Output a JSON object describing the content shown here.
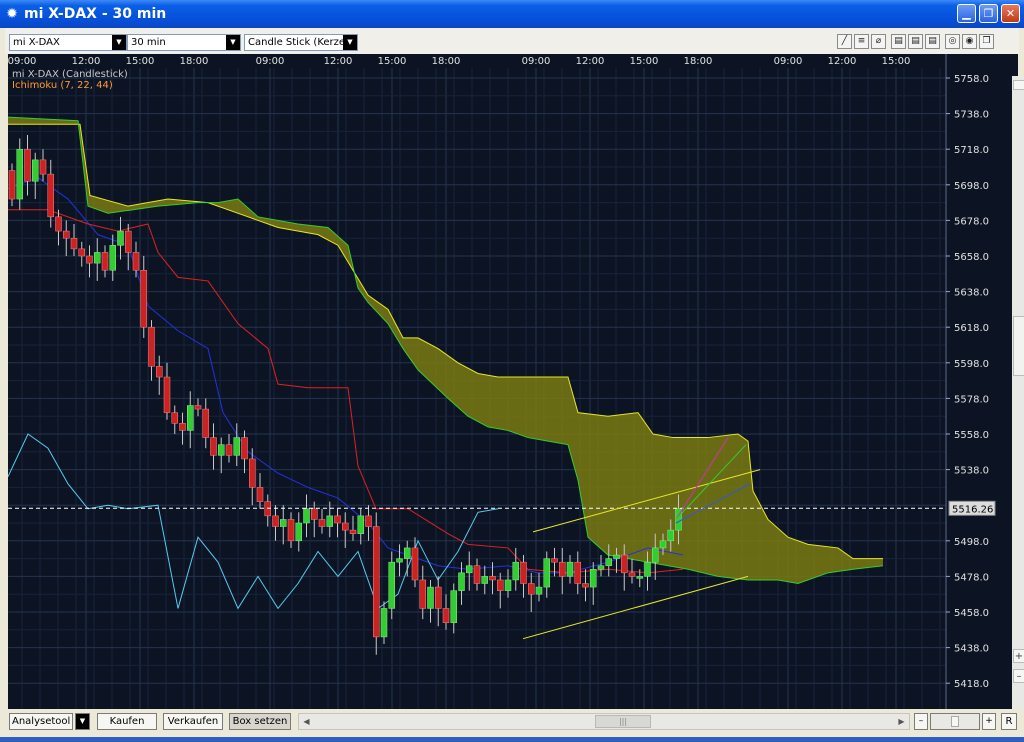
{
  "window": {
    "title": "mi X-DAX - 30 min",
    "app_icon": "sun-gear-icon",
    "buttons": [
      "minimize-icon",
      "restore-icon",
      "close-icon"
    ]
  },
  "toolbar": {
    "instrument": "mi X-DAX",
    "interval": "30 min",
    "chart_style": "Candle Stick (Kerze"
  },
  "chart": {
    "series_label": "mi X-DAX (Candlestick)",
    "indicator_label": "Ichimoku (7, 22, 44)",
    "time_labels": [
      "09:00",
      "12:00",
      "15:00",
      "18:00",
      "09:00",
      "12:00",
      "15:00",
      "18:00",
      "09:00",
      "12:00",
      "15:00",
      "18:00",
      "09:00",
      "12:00",
      "15:00"
    ],
    "price_labels": [
      "5758.0",
      "5738.0",
      "5718.0",
      "5698.0",
      "5678.0",
      "5658.0",
      "5638.0",
      "5618.0",
      "5598.0",
      "5578.0",
      "5558.0",
      "5538.0",
      "5498.0",
      "5478.0",
      "5458.0",
      "5438.0",
      "5418.0"
    ],
    "current_price": "5516.26",
    "colors": {
      "background": "#0c1424",
      "grid": "#24334e",
      "up": "#33cc33",
      "down": "#cc2222",
      "cloud_fill": "#7a7a12",
      "senkou_a": "#e6e62a",
      "senkou_b": "#33cc33",
      "tenkan": "#2233dd",
      "kijun": "#dd2222",
      "chikou": "#55ccee",
      "trendlines": "#e6e62a"
    }
  },
  "bottom": {
    "analysis_tool": "Analysetool",
    "buy": "Kaufen",
    "sell": "Verkaufen",
    "box": "Box setzen",
    "reset": "R"
  }
}
